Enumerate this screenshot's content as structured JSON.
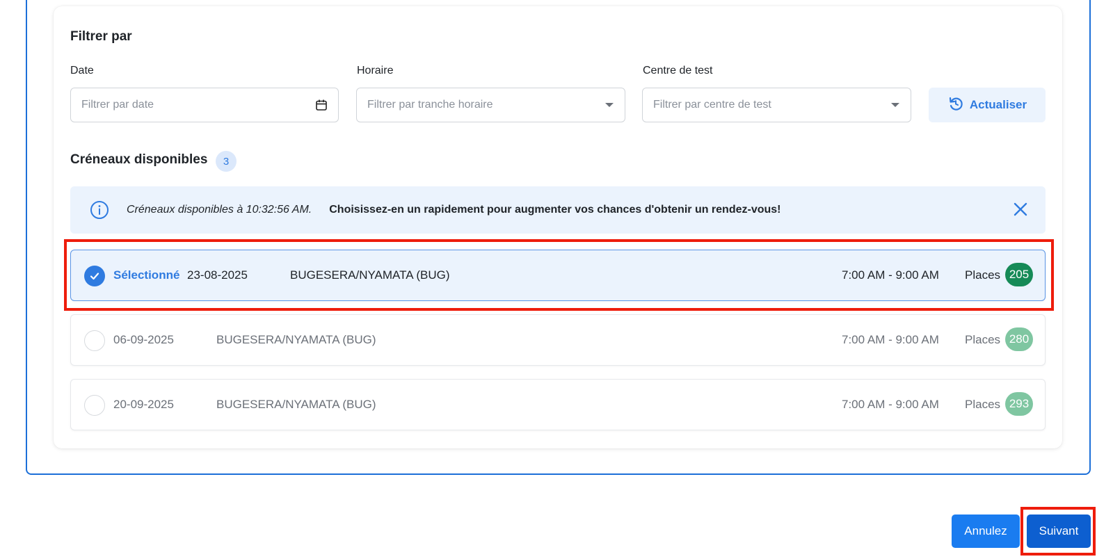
{
  "filter": {
    "title": "Filtrer par",
    "date_label": "Date",
    "date_placeholder": "Filtrer par date",
    "time_label": "Horaire",
    "time_placeholder": "Filtrer par tranche horaire",
    "center_label": "Centre de test",
    "center_placeholder": "Filtrer par centre de test",
    "refresh_label": "Actualiser"
  },
  "slots_section": {
    "title": "Créneaux disponibles",
    "count": "3"
  },
  "info_banner": {
    "italic_text": "Créneaux disponibles à 10:32:56 AM.",
    "bold_text": "Choisissez-en un rapidement pour augmenter vos chances d'obtenir un rendez-vous!"
  },
  "slots": [
    {
      "selected": true,
      "selected_label": "Sélectionné",
      "date": "23-08-2025",
      "center": "BUGESERA/NYAMATA (BUG)",
      "time": "7:00 AM - 9:00 AM",
      "places_label": "Places",
      "places": "205",
      "badge_color": "#168a57"
    },
    {
      "selected": false,
      "date": "06-09-2025",
      "center": "BUGESERA/NYAMATA (BUG)",
      "time": "7:00 AM - 9:00 AM",
      "places_label": "Places",
      "places": "280",
      "badge_color": "#7fc6a1"
    },
    {
      "selected": false,
      "date": "20-09-2025",
      "center": "BUGESERA/NYAMATA (BUG)",
      "time": "7:00 AM - 9:00 AM",
      "places_label": "Places",
      "places": "293",
      "badge_color": "#7fc6a1"
    }
  ],
  "footer": {
    "cancel_label": "Annulez",
    "next_label": "Suivant"
  },
  "colors": {
    "accent": "#2f7be0",
    "highlight": "#ee1d0c"
  }
}
